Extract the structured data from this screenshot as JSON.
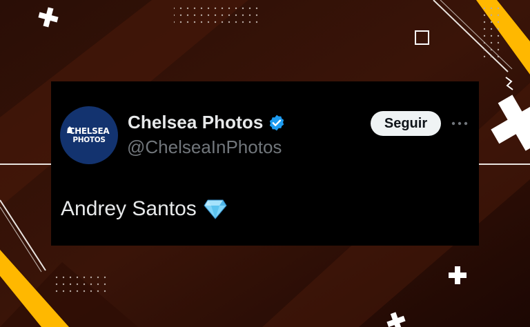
{
  "tweet": {
    "avatar": {
      "line1": "CHELSEA",
      "line2": "PHOTOS",
      "background": "#13336f"
    },
    "display_name": "Chelsea Photos",
    "handle": "@ChelseaInPhotos",
    "follow_label": "Seguir",
    "text": "Andrey Santos",
    "emoji_icon": "gem-icon",
    "verified_icon": "verified-badge-icon",
    "more_icon": "more-options-icon"
  },
  "colors": {
    "card_background": "#000000",
    "name": "#e7e9ea",
    "handle": "#71767b",
    "follow_button": "#eff3f4",
    "verified": "#1d9bf0",
    "accent_yellow": "#ffb800",
    "background": "#1a0804"
  }
}
